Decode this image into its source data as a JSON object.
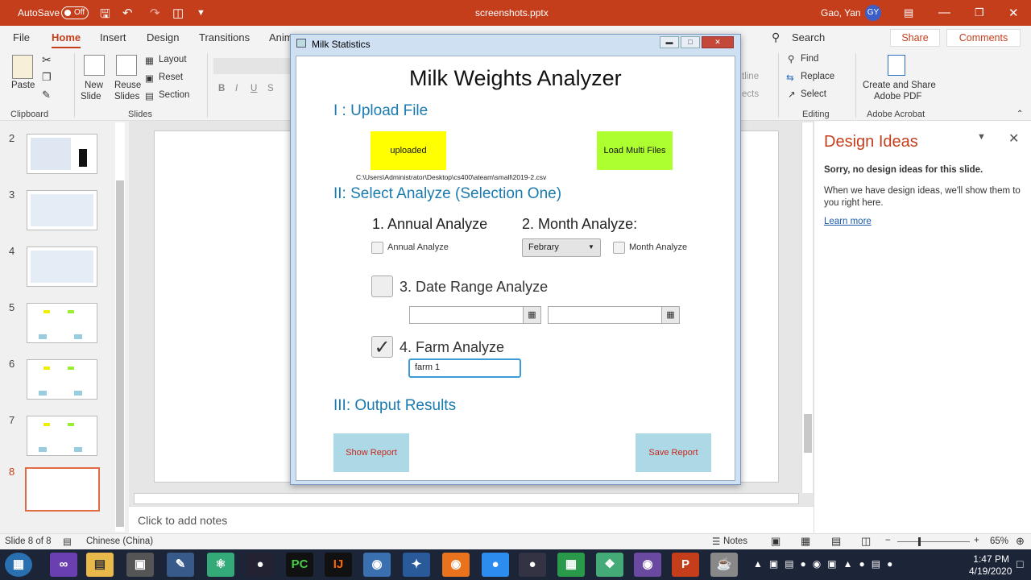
{
  "titlebar": {
    "autosave_label": "AutoSave",
    "autosave_state": "Off",
    "filename": "screenshots.pptx",
    "user": "Gao, Yan",
    "initials": "GY"
  },
  "tabs": [
    "File",
    "Home",
    "Insert",
    "Design",
    "Transitions",
    "Anim"
  ],
  "search_label": "Search",
  "share_label": "Share",
  "comments_label": "Comments",
  "ribbon": {
    "paste": "Paste",
    "clipboard": "Clipboard",
    "new_slide_1": "New",
    "new_slide_2": "Slide",
    "reuse_1": "Reuse",
    "reuse_2": "Slides",
    "layout": "Layout",
    "reset": "Reset",
    "section": "Section",
    "slides": "Slides",
    "font_bold": "B",
    "font_italic": "I",
    "font_underline": "U",
    "font_strike": "S",
    "outline_frag": "tline",
    "effects_frag": "ects",
    "find": "Find",
    "replace": "Replace",
    "select": "Select",
    "editing": "Editing",
    "create_share_1": "Create and Share",
    "create_share_2": "Adobe PDF",
    "adobe_acrobat": "Adobe Acrobat"
  },
  "thumbnails": [
    "2",
    "3",
    "4",
    "5",
    "6",
    "7",
    "8"
  ],
  "notes_placeholder": "Click to add notes",
  "design_ideas": {
    "title": "Design Ideas",
    "sorry": "Sorry, no design ideas for this slide.",
    "body": "When we have design ideas, we'll show them to you right here.",
    "link": "Learn more"
  },
  "status": {
    "slide": "Slide 8 of 8",
    "language": "Chinese (China)",
    "notes": "Notes",
    "zoom": "65%"
  },
  "taskbar": {
    "time": "1:47 PM",
    "date": "4/19/2020"
  },
  "app": {
    "window_title": "Milk Statistics",
    "heading": "Milk Weights Analyzer",
    "section1": "I : Upload File",
    "uploaded_btn": "uploaded",
    "load_multi_btn": "Load Multi Files",
    "file_path": "C:\\Users\\Administrator\\Desktop\\cs400\\ateam\\small\\2019-2.csv",
    "section2": "II: Select Analyze (Selection One)",
    "annual_title": "1. Annual Analyze",
    "annual_check": "Annual Analyze",
    "month_title": "2. Month Analyze:",
    "month_select": "Febrary",
    "month_check": "Month Analyze",
    "date_range_title": "3. Date Range Analyze",
    "farm_title": "4. Farm Analyze",
    "farm_value": "farm 1",
    "section3": "III: Output Results",
    "show_report": "Show Report",
    "save_report": "Save Report"
  }
}
